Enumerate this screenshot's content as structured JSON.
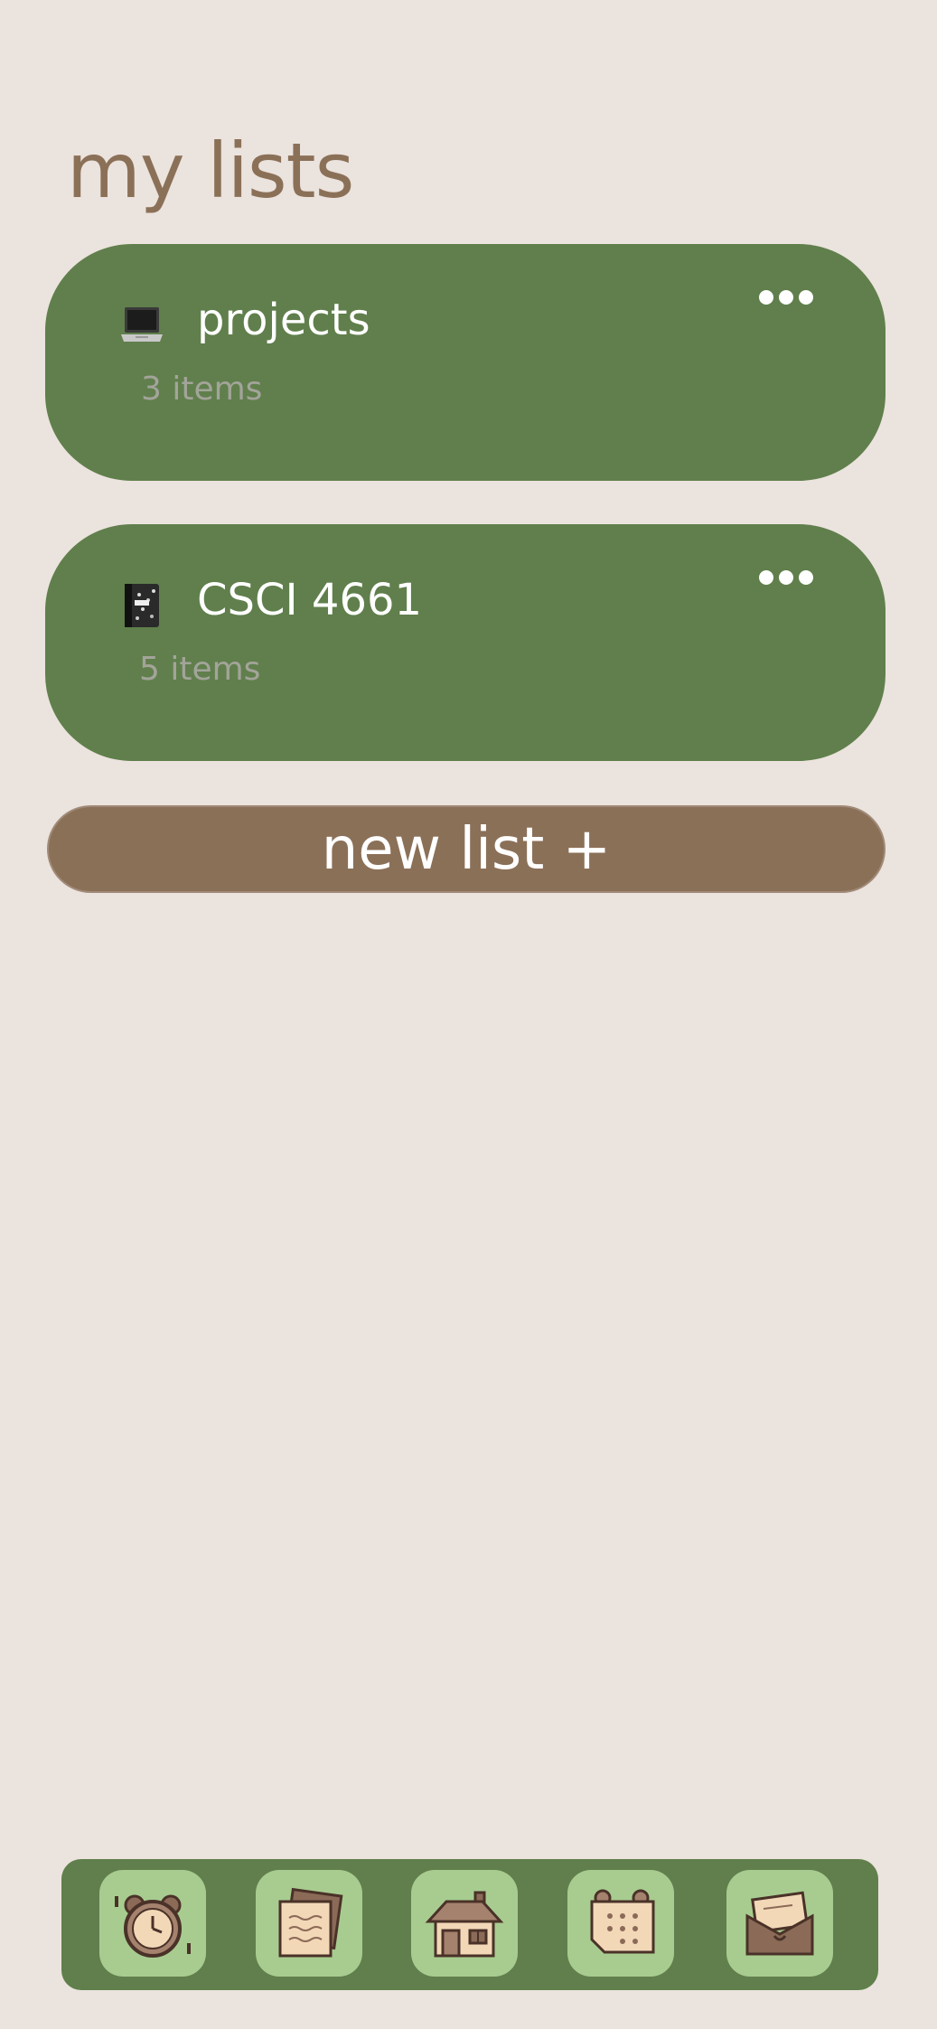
{
  "page": {
    "title": "my lists"
  },
  "lists": [
    {
      "icon": "laptop-icon",
      "title": "projects",
      "count": "3 items"
    },
    {
      "icon": "notebook-icon",
      "title": "CSCI 4661",
      "count": "5 items"
    }
  ],
  "new_list_label": "new list +",
  "colors": {
    "background": "#ebe3dd",
    "card": "#607f4c",
    "accent_brown": "#8b7058",
    "nav_tile": "#a8cc90",
    "item_count": "#a3a49a"
  },
  "nav": [
    {
      "name": "alarm-clock-icon"
    },
    {
      "name": "notes-icon"
    },
    {
      "name": "home-icon"
    },
    {
      "name": "calendar-icon"
    },
    {
      "name": "mail-icon"
    }
  ]
}
